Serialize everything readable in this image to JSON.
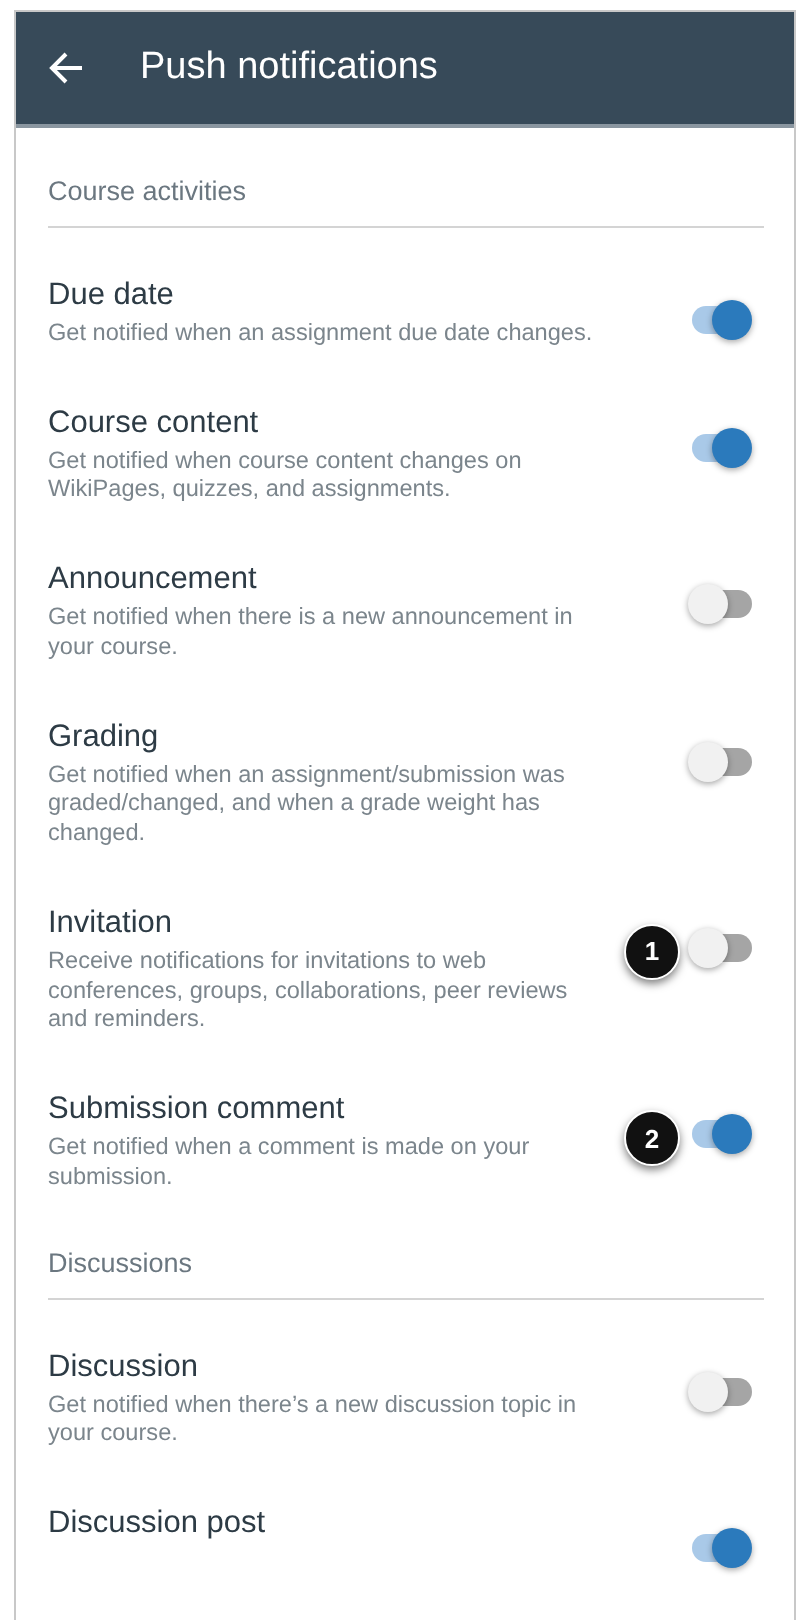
{
  "header": {
    "title": "Push notifications"
  },
  "sections": [
    {
      "title": "Course activities",
      "items": [
        {
          "title": "Due date",
          "description": "Get notified when an assignment due date changes.",
          "on": true
        },
        {
          "title": "Course content",
          "description": "Get notified when course content changes on WikiPages, quizzes, and assignments.",
          "on": true
        },
        {
          "title": "Announcement",
          "description": "Get notified when there is a new announcement in your course.",
          "on": false
        },
        {
          "title": "Grading",
          "description": "Get notified when an assignment/submission was graded/changed, and when a grade weight has changed.",
          "on": false
        },
        {
          "title": "Invitation",
          "description": "Receive notifications for invitations to web conferences, groups, collaborations, peer reviews and reminders.",
          "on": false,
          "callout": "1"
        },
        {
          "title": "Submission comment",
          "description": "Get notified when a comment is made on your submission.",
          "on": true,
          "callout": "2"
        }
      ]
    },
    {
      "title": "Discussions",
      "items": [
        {
          "title": "Discussion",
          "description": "Get notified when there’s a new discussion topic in your course.",
          "on": false
        },
        {
          "title": "Discussion post",
          "on": true
        }
      ]
    }
  ]
}
